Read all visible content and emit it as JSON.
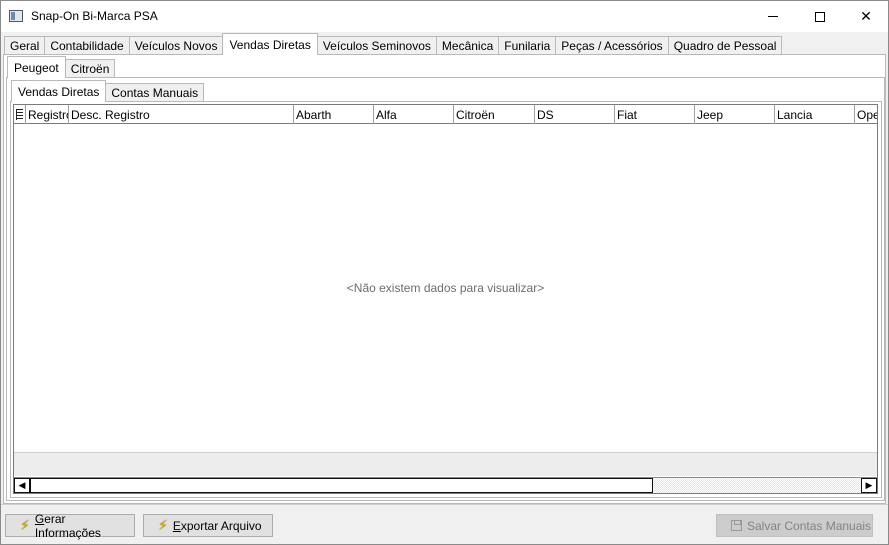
{
  "window": {
    "title": "Snap-On Bi-Marca PSA",
    "minimize": "minimize",
    "maximize": "maximize",
    "close": "✕"
  },
  "main_tabs": [
    {
      "label": "Geral",
      "active": false
    },
    {
      "label": "Contabilidade",
      "active": false
    },
    {
      "label": "Veículos Novos",
      "active": false
    },
    {
      "label": "Vendas Diretas",
      "active": true
    },
    {
      "label": "Veículos Seminovos",
      "active": false
    },
    {
      "label": "Mecânica",
      "active": false
    },
    {
      "label": "Funilaria",
      "active": false
    },
    {
      "label": "Peças / Acessórios",
      "active": false
    },
    {
      "label": "Quadro de Pessoal",
      "active": false
    }
  ],
  "brand_tabs": [
    {
      "label": "Peugeot",
      "active": true
    },
    {
      "label": "Citroën",
      "active": false
    }
  ],
  "sub_tabs": [
    {
      "label": "Vendas Diretas",
      "active": true
    },
    {
      "label": "Contas Manuais",
      "active": false
    }
  ],
  "grid": {
    "columns": [
      "Registro",
      "Desc. Registro",
      "Abarth",
      "Alfa",
      "Citroën",
      "DS",
      "Fiat",
      "Jeep",
      "Lancia",
      "Ope"
    ],
    "empty_message": "<Não existem dados para visualizar>",
    "scroll_thumb_fraction": 0.75
  },
  "buttons": {
    "gerar_prefix": "G",
    "gerar_rest": "erar Informações",
    "exportar_prefix": "E",
    "exportar_rest": "xportar Arquivo",
    "salvar": "Salvar Contas Manuais"
  },
  "icons": {
    "bolt": "⚡",
    "left_arrow": "◀",
    "right_arrow": "▶"
  }
}
